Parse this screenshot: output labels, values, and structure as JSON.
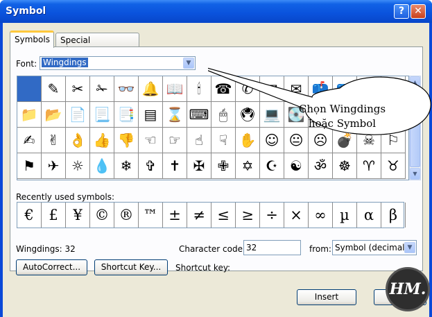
{
  "window": {
    "title": "Symbol",
    "help_glyph": "?",
    "close_glyph": "✕"
  },
  "tabs": [
    {
      "label": "Symbols",
      "active": true
    },
    {
      "label": "Special Characters",
      "active": false
    }
  ],
  "font": {
    "label": "Font:",
    "value": "Wingdings"
  },
  "grid": {
    "rows": [
      [
        "",
        "✎",
        "✂",
        "✁",
        "👓",
        "🔔",
        "📖",
        "🕯",
        "☎",
        "✆",
        "✉",
        "✉",
        "📫",
        "📪",
        "📬",
        "📭"
      ],
      [
        "📁",
        "📂",
        "📄",
        "📃",
        "📑",
        "▤",
        "⌛",
        "⌨",
        "🖱",
        "🖲",
        "💻",
        "💽",
        "💾",
        "💿",
        "✇",
        "✍"
      ],
      [
        "✍",
        "✌",
        "👌",
        "👍",
        "👎",
        "☜",
        "☞",
        "☝",
        "☟",
        "✋",
        "☺",
        "😐",
        "☹",
        "💣",
        "☠",
        "⚐"
      ],
      [
        "⚑",
        "✈",
        "☼",
        "💧",
        "❄",
        "✞",
        "✝",
        "✠",
        "✙",
        "✡",
        "☪",
        "☯",
        "ॐ",
        "☸",
        "♈",
        "♉"
      ]
    ],
    "selected": [
      0,
      0
    ]
  },
  "recent": {
    "label": "Recently used symbols:",
    "symbols": [
      "€",
      "£",
      "¥",
      "©",
      "®",
      "™",
      "±",
      "≠",
      "≤",
      "≥",
      "÷",
      "×",
      "∞",
      "µ",
      "α",
      "β"
    ]
  },
  "status": {
    "code_text": "Wingdings: 32",
    "char_code_label": "Character code:",
    "char_code_value": "32",
    "from_label": "from:",
    "from_value": "Symbol (decimal)",
    "shortcut_key_label": "Shortcut key:"
  },
  "buttons": {
    "autocorrect": "AutoCorrect...",
    "shortcut_key": "Shortcut Key...",
    "insert": "Insert",
    "cancel": "C"
  },
  "callout": {
    "line1": "Chọn Wingdings",
    "line2": "hoặc Symbol"
  },
  "logo": {
    "text": "HM."
  },
  "colors": {
    "selection": "#316ac5",
    "titlebar": "#0a52dc",
    "dialog": "#ece9d8",
    "tab_highlight": "#ffc83c"
  }
}
